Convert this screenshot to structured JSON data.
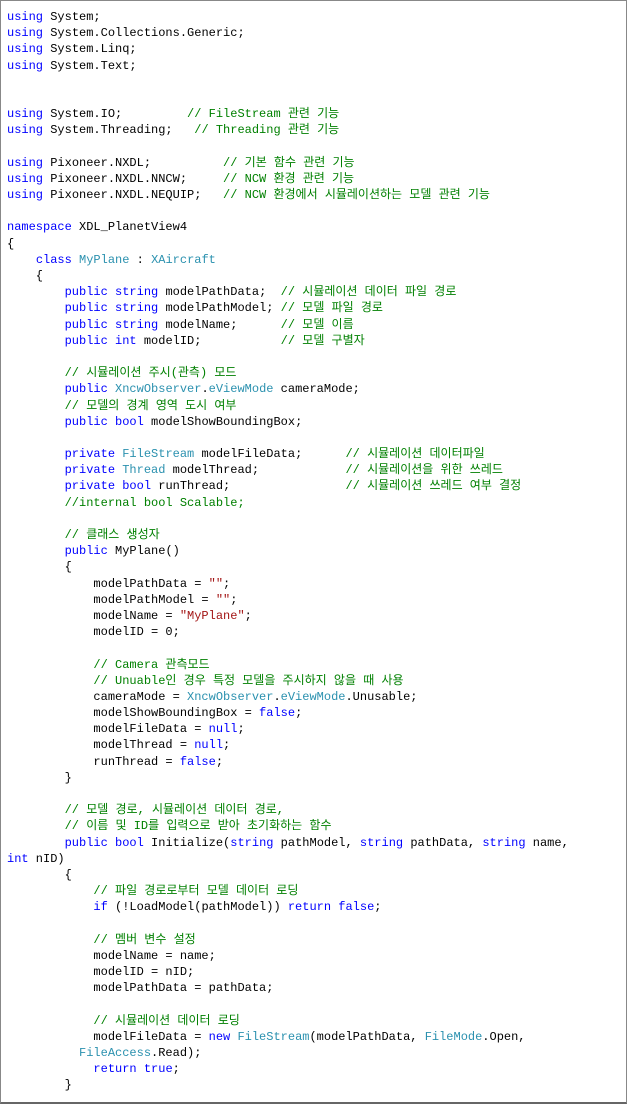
{
  "code": {
    "tokens": [
      {
        "t": "using",
        "c": "kw"
      },
      {
        "t": " System;\n",
        "c": "plain"
      },
      {
        "t": "using",
        "c": "kw"
      },
      {
        "t": " System.Collections.Generic;\n",
        "c": "plain"
      },
      {
        "t": "using",
        "c": "kw"
      },
      {
        "t": " System.Linq;\n",
        "c": "plain"
      },
      {
        "t": "using",
        "c": "kw"
      },
      {
        "t": " System.Text;\n",
        "c": "plain"
      },
      {
        "t": "\n\n",
        "c": "plain"
      },
      {
        "t": "using",
        "c": "kw"
      },
      {
        "t": " System.IO;         ",
        "c": "plain"
      },
      {
        "t": "// FileStream 관련 기능",
        "c": "comment"
      },
      {
        "t": "\n",
        "c": "plain"
      },
      {
        "t": "using",
        "c": "kw"
      },
      {
        "t": " System.Threading;   ",
        "c": "plain"
      },
      {
        "t": "// Threading 관련 기능",
        "c": "comment"
      },
      {
        "t": "\n",
        "c": "plain"
      },
      {
        "t": "\n",
        "c": "plain"
      },
      {
        "t": "using",
        "c": "kw"
      },
      {
        "t": " Pixoneer.NXDL;          ",
        "c": "plain"
      },
      {
        "t": "// 기본 함수 관련 기능",
        "c": "comment"
      },
      {
        "t": "\n",
        "c": "plain"
      },
      {
        "t": "using",
        "c": "kw"
      },
      {
        "t": " Pixoneer.NXDL.NNCW;     ",
        "c": "plain"
      },
      {
        "t": "// NCW 환경 관련 기능",
        "c": "comment"
      },
      {
        "t": "\n",
        "c": "plain"
      },
      {
        "t": "using",
        "c": "kw"
      },
      {
        "t": " Pixoneer.NXDL.NEQUIP;   ",
        "c": "plain"
      },
      {
        "t": "// NCW 환경에서 시뮬레이션하는 모델 관련 기능",
        "c": "comment"
      },
      {
        "t": "\n",
        "c": "plain"
      },
      {
        "t": "\n",
        "c": "plain"
      },
      {
        "t": "namespace",
        "c": "kw"
      },
      {
        "t": " XDL_PlanetView4\n",
        "c": "plain"
      },
      {
        "t": "{\n",
        "c": "plain"
      },
      {
        "t": "    ",
        "c": "plain"
      },
      {
        "t": "class",
        "c": "kw"
      },
      {
        "t": " ",
        "c": "plain"
      },
      {
        "t": "MyPlane",
        "c": "type"
      },
      {
        "t": " : ",
        "c": "plain"
      },
      {
        "t": "XAircraft",
        "c": "type"
      },
      {
        "t": "\n",
        "c": "plain"
      },
      {
        "t": "    {\n",
        "c": "plain"
      },
      {
        "t": "        ",
        "c": "plain"
      },
      {
        "t": "public",
        "c": "kw"
      },
      {
        "t": " ",
        "c": "plain"
      },
      {
        "t": "string",
        "c": "kw"
      },
      {
        "t": " modelPathData;  ",
        "c": "plain"
      },
      {
        "t": "// 시뮬레이션 데이터 파일 경로",
        "c": "comment"
      },
      {
        "t": "\n",
        "c": "plain"
      },
      {
        "t": "        ",
        "c": "plain"
      },
      {
        "t": "public",
        "c": "kw"
      },
      {
        "t": " ",
        "c": "plain"
      },
      {
        "t": "string",
        "c": "kw"
      },
      {
        "t": " modelPathModel; ",
        "c": "plain"
      },
      {
        "t": "// 모델 파일 경로",
        "c": "comment"
      },
      {
        "t": "\n",
        "c": "plain"
      },
      {
        "t": "        ",
        "c": "plain"
      },
      {
        "t": "public",
        "c": "kw"
      },
      {
        "t": " ",
        "c": "plain"
      },
      {
        "t": "string",
        "c": "kw"
      },
      {
        "t": " modelName;      ",
        "c": "plain"
      },
      {
        "t": "// 모델 이름",
        "c": "comment"
      },
      {
        "t": "\n",
        "c": "plain"
      },
      {
        "t": "        ",
        "c": "plain"
      },
      {
        "t": "public",
        "c": "kw"
      },
      {
        "t": " ",
        "c": "plain"
      },
      {
        "t": "int",
        "c": "kw"
      },
      {
        "t": " modelID;           ",
        "c": "plain"
      },
      {
        "t": "// 모델 구별자",
        "c": "comment"
      },
      {
        "t": "\n",
        "c": "plain"
      },
      {
        "t": "\n",
        "c": "plain"
      },
      {
        "t": "        ",
        "c": "plain"
      },
      {
        "t": "// 시뮬레이션 주시(관측) 모드",
        "c": "comment"
      },
      {
        "t": "\n",
        "c": "plain"
      },
      {
        "t": "        ",
        "c": "plain"
      },
      {
        "t": "public",
        "c": "kw"
      },
      {
        "t": " ",
        "c": "plain"
      },
      {
        "t": "XncwObserver",
        "c": "type"
      },
      {
        "t": ".",
        "c": "plain"
      },
      {
        "t": "eViewMode",
        "c": "type"
      },
      {
        "t": " cameraMode;\n",
        "c": "plain"
      },
      {
        "t": "        ",
        "c": "plain"
      },
      {
        "t": "// 모델의 경계 영역 도시 여부",
        "c": "comment"
      },
      {
        "t": "\n",
        "c": "plain"
      },
      {
        "t": "        ",
        "c": "plain"
      },
      {
        "t": "public",
        "c": "kw"
      },
      {
        "t": " ",
        "c": "plain"
      },
      {
        "t": "bool",
        "c": "kw"
      },
      {
        "t": " modelShowBoundingBox;\n",
        "c": "plain"
      },
      {
        "t": "\n",
        "c": "plain"
      },
      {
        "t": "        ",
        "c": "plain"
      },
      {
        "t": "private",
        "c": "kw"
      },
      {
        "t": " ",
        "c": "plain"
      },
      {
        "t": "FileStream",
        "c": "type"
      },
      {
        "t": " modelFileData;      ",
        "c": "plain"
      },
      {
        "t": "// 시뮬레이션 데이터파일",
        "c": "comment"
      },
      {
        "t": "\n",
        "c": "plain"
      },
      {
        "t": "        ",
        "c": "plain"
      },
      {
        "t": "private",
        "c": "kw"
      },
      {
        "t": " ",
        "c": "plain"
      },
      {
        "t": "Thread",
        "c": "type"
      },
      {
        "t": " modelThread;            ",
        "c": "plain"
      },
      {
        "t": "// 시뮬레이션을 위한 쓰레드",
        "c": "comment"
      },
      {
        "t": "\n",
        "c": "plain"
      },
      {
        "t": "        ",
        "c": "plain"
      },
      {
        "t": "private",
        "c": "kw"
      },
      {
        "t": " ",
        "c": "plain"
      },
      {
        "t": "bool",
        "c": "kw"
      },
      {
        "t": " runThread;                ",
        "c": "plain"
      },
      {
        "t": "// 시뮬레이션 쓰레드 여부 결정",
        "c": "comment"
      },
      {
        "t": "\n",
        "c": "plain"
      },
      {
        "t": "        ",
        "c": "plain"
      },
      {
        "t": "//internal bool Scalable;",
        "c": "comment"
      },
      {
        "t": "\n",
        "c": "plain"
      },
      {
        "t": "\n",
        "c": "plain"
      },
      {
        "t": "        ",
        "c": "plain"
      },
      {
        "t": "// 클래스 생성자",
        "c": "comment"
      },
      {
        "t": "\n",
        "c": "plain"
      },
      {
        "t": "        ",
        "c": "plain"
      },
      {
        "t": "public",
        "c": "kw"
      },
      {
        "t": " MyPlane()\n",
        "c": "plain"
      },
      {
        "t": "        {\n",
        "c": "plain"
      },
      {
        "t": "            modelPathData = ",
        "c": "plain"
      },
      {
        "t": "\"\"",
        "c": "str"
      },
      {
        "t": ";\n",
        "c": "plain"
      },
      {
        "t": "            modelPathModel = ",
        "c": "plain"
      },
      {
        "t": "\"\"",
        "c": "str"
      },
      {
        "t": ";\n",
        "c": "plain"
      },
      {
        "t": "            modelName = ",
        "c": "plain"
      },
      {
        "t": "\"MyPlane\"",
        "c": "str"
      },
      {
        "t": ";\n",
        "c": "plain"
      },
      {
        "t": "            modelID = 0;\n",
        "c": "plain"
      },
      {
        "t": "\n",
        "c": "plain"
      },
      {
        "t": "            ",
        "c": "plain"
      },
      {
        "t": "// Camera 관측모드",
        "c": "comment"
      },
      {
        "t": "\n",
        "c": "plain"
      },
      {
        "t": "            ",
        "c": "plain"
      },
      {
        "t": "// Unuable인 경우 특정 모델을 주시하지 않을 때 사용",
        "c": "comment"
      },
      {
        "t": "\n",
        "c": "plain"
      },
      {
        "t": "            cameraMode = ",
        "c": "plain"
      },
      {
        "t": "XncwObserver",
        "c": "type"
      },
      {
        "t": ".",
        "c": "plain"
      },
      {
        "t": "eViewMode",
        "c": "type"
      },
      {
        "t": ".Unusable;\n",
        "c": "plain"
      },
      {
        "t": "            modelShowBoundingBox = ",
        "c": "plain"
      },
      {
        "t": "false",
        "c": "kw"
      },
      {
        "t": ";\n",
        "c": "plain"
      },
      {
        "t": "            modelFileData = ",
        "c": "plain"
      },
      {
        "t": "null",
        "c": "kw"
      },
      {
        "t": ";\n",
        "c": "plain"
      },
      {
        "t": "            modelThread = ",
        "c": "plain"
      },
      {
        "t": "null",
        "c": "kw"
      },
      {
        "t": ";\n",
        "c": "plain"
      },
      {
        "t": "            runThread = ",
        "c": "plain"
      },
      {
        "t": "false",
        "c": "kw"
      },
      {
        "t": ";\n",
        "c": "plain"
      },
      {
        "t": "        }\n",
        "c": "plain"
      },
      {
        "t": "\n",
        "c": "plain"
      },
      {
        "t": "        ",
        "c": "plain"
      },
      {
        "t": "// 모델 경로, 시뮬레이션 데이터 경로,",
        "c": "comment"
      },
      {
        "t": "\n",
        "c": "plain"
      },
      {
        "t": "        ",
        "c": "plain"
      },
      {
        "t": "// 이름 및 ID를 입력으로 받아 초기화하는 함수",
        "c": "comment"
      },
      {
        "t": "\n",
        "c": "plain"
      },
      {
        "t": "        ",
        "c": "plain"
      },
      {
        "t": "public",
        "c": "kw"
      },
      {
        "t": " ",
        "c": "plain"
      },
      {
        "t": "bool",
        "c": "kw"
      },
      {
        "t": " Initialize(",
        "c": "plain"
      },
      {
        "t": "string",
        "c": "kw"
      },
      {
        "t": " pathModel, ",
        "c": "plain"
      },
      {
        "t": "string",
        "c": "kw"
      },
      {
        "t": " pathData, ",
        "c": "plain"
      },
      {
        "t": "string",
        "c": "kw"
      },
      {
        "t": " name, \n",
        "c": "plain"
      },
      {
        "t": "int",
        "c": "kw"
      },
      {
        "t": " nID)\n",
        "c": "plain"
      },
      {
        "t": "        {\n",
        "c": "plain"
      },
      {
        "t": "            ",
        "c": "plain"
      },
      {
        "t": "// 파일 경로로부터 모델 데이터 로딩",
        "c": "comment"
      },
      {
        "t": "\n",
        "c": "plain"
      },
      {
        "t": "            ",
        "c": "plain"
      },
      {
        "t": "if",
        "c": "kw"
      },
      {
        "t": " (!LoadModel(pathModel)) ",
        "c": "plain"
      },
      {
        "t": "return",
        "c": "kw"
      },
      {
        "t": " ",
        "c": "plain"
      },
      {
        "t": "false",
        "c": "kw"
      },
      {
        "t": ";\n",
        "c": "plain"
      },
      {
        "t": "\n",
        "c": "plain"
      },
      {
        "t": "            ",
        "c": "plain"
      },
      {
        "t": "// 멤버 변수 설정",
        "c": "comment"
      },
      {
        "t": "\n",
        "c": "plain"
      },
      {
        "t": "            modelName = name;\n",
        "c": "plain"
      },
      {
        "t": "            modelID = nID;\n",
        "c": "plain"
      },
      {
        "t": "            modelPathData = pathData;\n",
        "c": "plain"
      },
      {
        "t": "\n",
        "c": "plain"
      },
      {
        "t": "            ",
        "c": "plain"
      },
      {
        "t": "// 시뮬레이션 데이터 로딩",
        "c": "comment"
      },
      {
        "t": "\n",
        "c": "plain"
      },
      {
        "t": "            modelFileData = ",
        "c": "plain"
      },
      {
        "t": "new",
        "c": "kw"
      },
      {
        "t": " ",
        "c": "plain"
      },
      {
        "t": "FileStream",
        "c": "type"
      },
      {
        "t": "(modelPathData, ",
        "c": "plain"
      },
      {
        "t": "FileMode",
        "c": "type"
      },
      {
        "t": ".Open, \n",
        "c": "plain"
      },
      {
        "t": "          ",
        "c": "plain"
      },
      {
        "t": "FileAccess",
        "c": "type"
      },
      {
        "t": ".Read);\n",
        "c": "plain"
      },
      {
        "t": "            ",
        "c": "plain"
      },
      {
        "t": "return",
        "c": "kw"
      },
      {
        "t": " ",
        "c": "plain"
      },
      {
        "t": "true",
        "c": "kw"
      },
      {
        "t": ";\n",
        "c": "plain"
      },
      {
        "t": "        }\n",
        "c": "plain"
      }
    ]
  }
}
